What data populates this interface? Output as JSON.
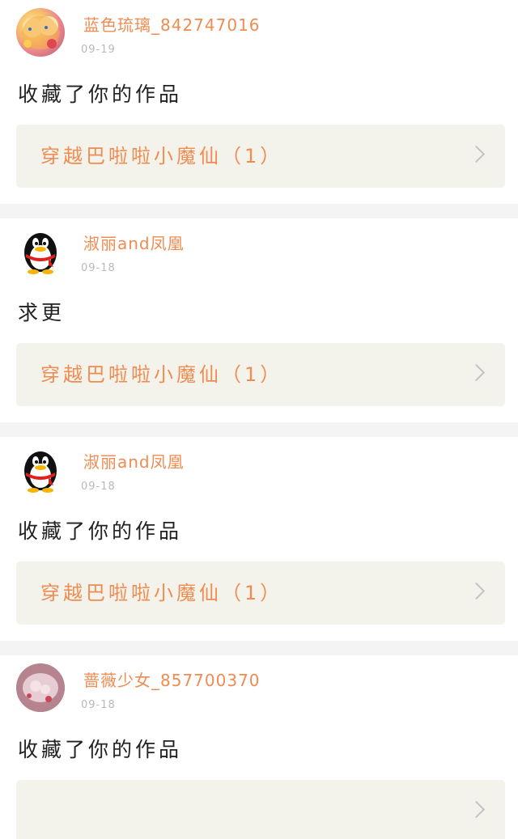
{
  "feed": [
    {
      "avatar": "anime-girl-avatar",
      "username": "蓝色琉璃_842747016",
      "date": "09-19",
      "message": "收藏了你的作品",
      "work_title": "穿越巴啦啦小魔仙（1）"
    },
    {
      "avatar": "qq-penguin-avatar",
      "username": "淑丽and凤凰",
      "date": "09-18",
      "message": "求更",
      "work_title": "穿越巴啦啦小魔仙（1）"
    },
    {
      "avatar": "qq-penguin-avatar",
      "username": "淑丽and凤凰",
      "date": "09-18",
      "message": "收藏了你的作品",
      "work_title": "穿越巴啦啦小魔仙（1）"
    },
    {
      "avatar": "rose-photo-avatar",
      "username": "蔷薇少女_857700370",
      "date": "09-18",
      "message": "收藏了你的作品",
      "work_title": ""
    }
  ],
  "colors": {
    "accent": "#f08c52",
    "date": "#b9b9b9",
    "box_bg": "#f3f3ec",
    "divider": "#f4f4f4"
  }
}
